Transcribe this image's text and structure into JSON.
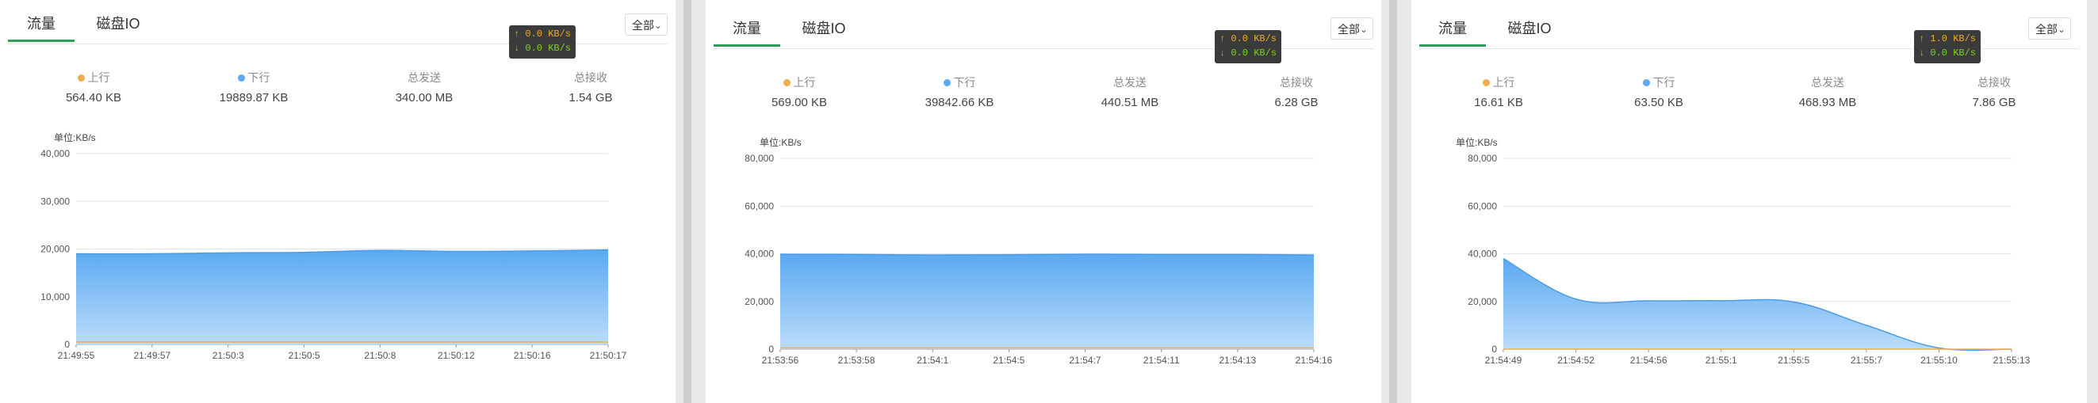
{
  "tab_labels": {
    "traffic": "流量",
    "disk_io": "磁盘IO"
  },
  "select_label": "全部",
  "stat_labels": {
    "upload": "上行",
    "download": "下行",
    "total_sent": "总发送",
    "total_received": "总接收"
  },
  "unit_label": "单位:KB/s",
  "colors": {
    "upload": "#f0ad4e",
    "download": "#5aa9f2",
    "active_tab": "#2f9e5b",
    "tooltip_up": "#f0ad28",
    "tooltip_down": "#7fd321"
  },
  "panels": [
    {
      "tooltip": {
        "up": "↑ 0.0 KB/s",
        "down": "↓ 0.0 KB/s"
      },
      "stats": {
        "upload": "564.40 KB",
        "download": "19889.87 KB",
        "total_sent": "340.00 MB",
        "total_received": "1.54 GB"
      }
    },
    {
      "tooltip": {
        "up": "↑ 0.0 KB/s",
        "down": "↓ 0.0 KB/s"
      },
      "stats": {
        "upload": "569.00 KB",
        "download": "39842.66 KB",
        "total_sent": "440.51 MB",
        "total_received": "6.28 GB"
      }
    },
    {
      "tooltip": {
        "up": "↑ 1.0 KB/s",
        "down": "↓ 0.0 KB/s"
      },
      "stats": {
        "upload": "16.61 KB",
        "download": "63.50 KB",
        "total_sent": "468.93 MB",
        "total_received": "7.86 GB"
      }
    }
  ],
  "chart_data": [
    {
      "type": "area",
      "ylabel": "单位:KB/s",
      "ylim": [
        0,
        40000
      ],
      "yticks": [
        "0",
        "10,000",
        "20,000",
        "30,000",
        "40,000"
      ],
      "x": [
        "21:49:55",
        "21:49:57",
        "21:50:3",
        "21:50:5",
        "21:50:8",
        "21:50:12",
        "21:50:16",
        "21:50:17"
      ],
      "series": [
        {
          "name": "上行",
          "values": [
            500,
            500,
            500,
            500,
            500,
            500,
            500,
            500
          ]
        },
        {
          "name": "下行",
          "values": [
            19000,
            19000,
            19200,
            19300,
            19700,
            19500,
            19600,
            19800
          ]
        }
      ],
      "grid": true
    },
    {
      "type": "area",
      "ylabel": "单位:KB/s",
      "ylim": [
        0,
        80000
      ],
      "yticks": [
        "0",
        "20,000",
        "40,000",
        "60,000",
        "80,000"
      ],
      "x": [
        "21:53:56",
        "21:53:58",
        "21:54:1",
        "21:54:5",
        "21:54:7",
        "21:54:11",
        "21:54:13",
        "21:54:16"
      ],
      "series": [
        {
          "name": "上行",
          "values": [
            500,
            500,
            500,
            500,
            500,
            500,
            500,
            500
          ]
        },
        {
          "name": "下行",
          "values": [
            39800,
            39700,
            39500,
            39600,
            39800,
            39700,
            39700,
            39500
          ]
        }
      ],
      "grid": true
    },
    {
      "type": "area",
      "ylabel": "单位:KB/s",
      "ylim": [
        0,
        80000
      ],
      "yticks": [
        "0",
        "20,000",
        "40,000",
        "60,000",
        "80,000"
      ],
      "x": [
        "21:54:49",
        "21:54:52",
        "21:54:56",
        "21:55:1",
        "21:55:5",
        "21:55:7",
        "21:55:10",
        "21:55:13"
      ],
      "series": [
        {
          "name": "上行",
          "values": [
            0,
            0,
            0,
            0,
            0,
            0,
            0,
            0
          ]
        },
        {
          "name": "下行",
          "values": [
            38000,
            21000,
            20300,
            20300,
            19800,
            10000,
            500,
            0
          ]
        }
      ],
      "grid": true
    }
  ]
}
